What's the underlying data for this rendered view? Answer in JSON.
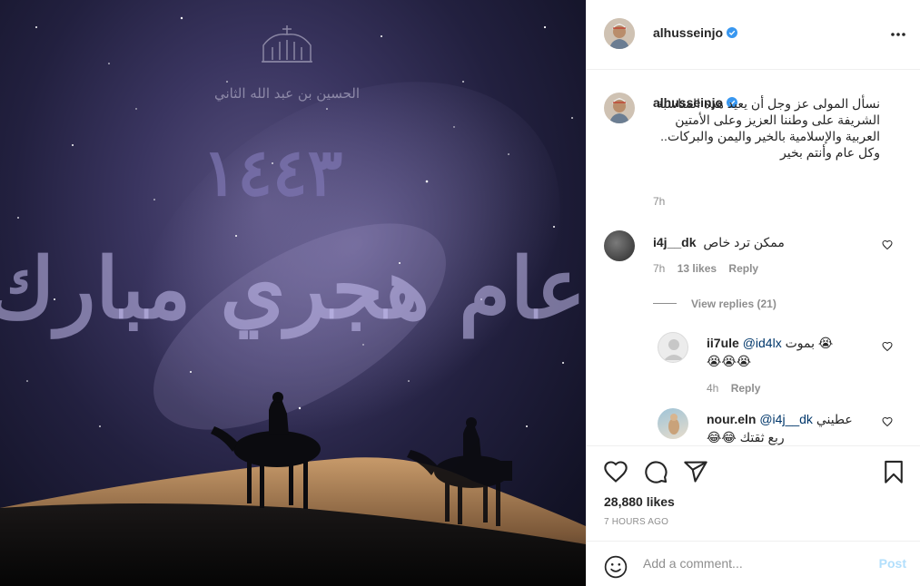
{
  "post": {
    "image_text": {
      "signature": "الحسين بن عبد الله الثاني",
      "year": "١٤٤٣",
      "greeting": "عام هجري مبارك"
    }
  },
  "author": {
    "username": "alhusseinjo",
    "verified": true
  },
  "caption": {
    "username": "alhusseinjo",
    "text": "نسأل المولى عز وجل أن يعيد هذه المناسبة الشريفة على وطننا العزيز وعلى الأمتين العربية والإسلامية بالخير واليمن والبركات.. وكل عام وأنتم بخير",
    "time": "7h"
  },
  "comments": [
    {
      "username": "i4j__dk",
      "text": "ممكن ترد خاص",
      "time": "7h",
      "likes": "13 likes",
      "reply_label": "Reply",
      "view_replies": "View replies (21)",
      "replies": [
        {
          "username": "ii7ule",
          "mention": "@id4lx",
          "text": "بموت 😭",
          "emoji_line": "😭😭😭",
          "time": "4h",
          "reply_label": "Reply"
        },
        {
          "username": "nour.eln",
          "mention": "@i4j__dk",
          "text": "عطيني",
          "line2": "ربع ثقتك 😂😂"
        }
      ]
    }
  ],
  "stats": {
    "likes": "28,880 likes",
    "time_ago": "7 HOURS AGO"
  },
  "add_comment": {
    "placeholder": "Add a comment...",
    "post_label": "Post"
  },
  "colors": {
    "verified": "#3897f0",
    "link": "#00376b",
    "secondary": "#8e8e8e",
    "post_disabled": "#b2dffc"
  },
  "icons": [
    "more-icon",
    "heart-icon",
    "comment-icon",
    "share-icon",
    "bookmark-icon",
    "emoji-icon",
    "verified-icon"
  ]
}
